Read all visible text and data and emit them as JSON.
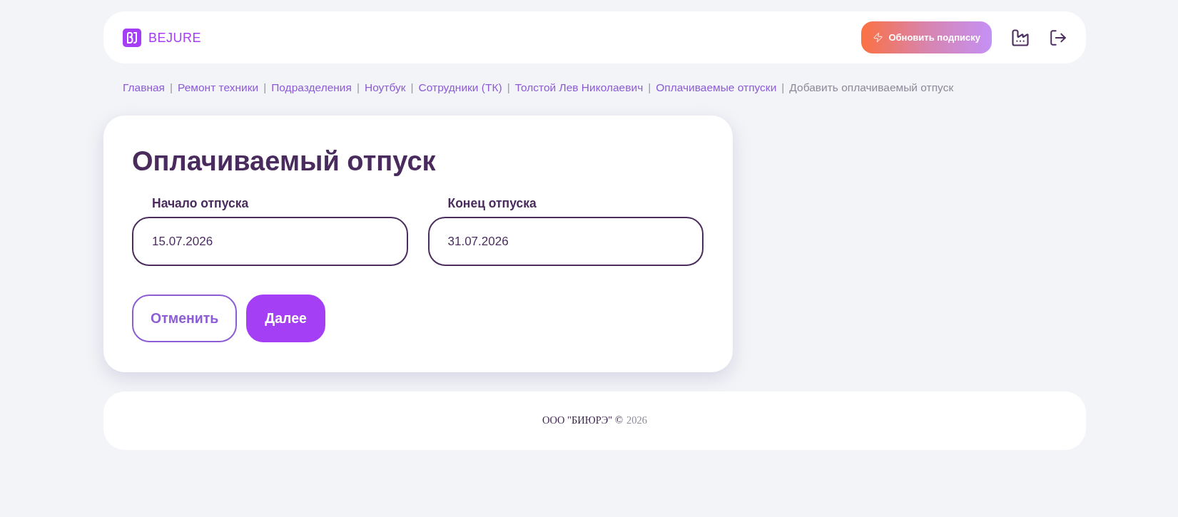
{
  "header": {
    "logo": {
      "text": "BEJURE"
    },
    "upgrade_button": {
      "label": "Обновить подписку"
    }
  },
  "breadcrumbs": {
    "separator": "|",
    "items": [
      {
        "label": "Главная",
        "kind": "link"
      },
      {
        "label": "Ремонт техники",
        "kind": "link"
      },
      {
        "label": "Подразделения",
        "kind": "link"
      },
      {
        "label": "Ноутбук",
        "kind": "link"
      },
      {
        "label": "Сотрудники (ТК)",
        "kind": "link"
      },
      {
        "label": "Толстой Лев Николаевич",
        "kind": "link"
      },
      {
        "label": "Оплачиваемые отпуски",
        "kind": "link"
      },
      {
        "label": "Добавить оплачиваемый отпуск",
        "kind": "current"
      }
    ]
  },
  "form": {
    "title": "Оплачиваемый отпуск",
    "fields": [
      {
        "label": "Начало отпуска",
        "value": "15.07.2026"
      },
      {
        "label": "Конец отпуска",
        "value": "31.07.2026"
      }
    ],
    "buttons": [
      {
        "label": "Отменить",
        "kind": "secondary"
      },
      {
        "label": "Далее",
        "kind": "primary"
      }
    ]
  },
  "footer": {
    "company": "ООО \"БИЮРЭ\" ©",
    "year": "2026"
  }
}
